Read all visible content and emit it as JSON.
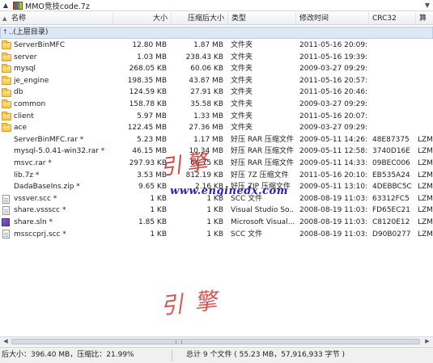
{
  "address_bar": {
    "path": "MMO竞技code.7z",
    "back_icon": "up-arrow-icon",
    "archive_icon": "archive-icon",
    "dropdown_icon": "chevron-down-icon"
  },
  "columns": {
    "name": "名称",
    "size": "大小",
    "packed": "压缩后大小",
    "type": "类型",
    "modified": "修改时间",
    "crc": "CRC32",
    "extra": "算"
  },
  "parent_row": {
    "label": "..(上层目录)"
  },
  "files": [
    {
      "icon": "folder",
      "name": "ServerBinMFC",
      "size": "12.80 MB",
      "packed": "1.87 MB",
      "type": "文件夹",
      "modified": "2011-05-16 20:09:...",
      "crc": "",
      "extra": ""
    },
    {
      "icon": "folder",
      "name": "server",
      "size": "1.03 MB",
      "packed": "238.43 KB",
      "type": "文件夹",
      "modified": "2011-05-16 19:39:...",
      "crc": "",
      "extra": ""
    },
    {
      "icon": "folder",
      "name": "mysql",
      "size": "268.05 KB",
      "packed": "60.06 KB",
      "type": "文件夹",
      "modified": "2009-03-27 09:29:...",
      "crc": "",
      "extra": ""
    },
    {
      "icon": "folder",
      "name": "je_engine",
      "size": "198.35 MB",
      "packed": "43.87 MB",
      "type": "文件夹",
      "modified": "2011-05-16 20:57:...",
      "crc": "",
      "extra": ""
    },
    {
      "icon": "folder",
      "name": "db",
      "size": "124.59 KB",
      "packed": "27.91 KB",
      "type": "文件夹",
      "modified": "2011-05-16 20:46:...",
      "crc": "",
      "extra": ""
    },
    {
      "icon": "folder",
      "name": "common",
      "size": "158.78 KB",
      "packed": "35.58 KB",
      "type": "文件夹",
      "modified": "2009-03-27 09:29:...",
      "crc": "",
      "extra": ""
    },
    {
      "icon": "folder",
      "name": "client",
      "size": "5.97 MB",
      "packed": "1.33 MB",
      "type": "文件夹",
      "modified": "2011-05-16 20:07:...",
      "crc": "",
      "extra": ""
    },
    {
      "icon": "folder",
      "name": "ace",
      "size": "122.45 MB",
      "packed": "27.36 MB",
      "type": "文件夹",
      "modified": "2009-03-27 09:29:...",
      "crc": "",
      "extra": ""
    },
    {
      "icon": "archive",
      "name": "ServerBinMFC.rar *",
      "size": "5.23 MB",
      "packed": "1.17 MB",
      "type": "好压 RAR 压缩文件",
      "modified": "2009-05-11 14:26:...",
      "crc": "48E87375",
      "extra": "LZM"
    },
    {
      "icon": "archive",
      "name": "mysql-5.0.41-win32.rar *",
      "size": "46.15 MB",
      "packed": "10.34 MB",
      "type": "好压 RAR 压缩文件",
      "modified": "2009-05-11 12:58:...",
      "crc": "3740D16E",
      "extra": "LZM"
    },
    {
      "icon": "archive",
      "name": "msvc.rar *",
      "size": "297.93 KB",
      "packed": "66.75 KB",
      "type": "好压 RAR 压缩文件",
      "modified": "2009-05-11 14:33:...",
      "crc": "09BEC006",
      "extra": "LZM"
    },
    {
      "icon": "archive",
      "name": "lib.7z *",
      "size": "3.53 MB",
      "packed": "812.19 KB",
      "type": "好压 7Z 压缩文件",
      "modified": "2011-05-16 20:10:...",
      "crc": "EB535A24",
      "extra": "LZM"
    },
    {
      "icon": "archive",
      "name": "DadaBaseIns.zip *",
      "size": "9.65 KB",
      "packed": "2.16 KB",
      "type": "好压 ZIP 压缩文件",
      "modified": "2009-05-11 13:10:...",
      "crc": "4DEBBC5C",
      "extra": "LZM"
    },
    {
      "icon": "doc",
      "name": "vssver.scc *",
      "size": "1 KB",
      "packed": "1 KB",
      "type": "SCC 文件",
      "modified": "2008-08-19 11:03:...",
      "crc": "63312FC5",
      "extra": "LZM"
    },
    {
      "icon": "doc",
      "name": "share.vssscc *",
      "size": "1 KB",
      "packed": "1 KB",
      "type": "Visual Studio So...",
      "modified": "2008-08-19 11:03:...",
      "crc": "FD65EC21",
      "extra": "LZM"
    },
    {
      "icon": "sln",
      "name": "share.sln *",
      "size": "1.85 KB",
      "packed": "1 KB",
      "type": "Microsoft Visual...",
      "modified": "2008-08-19 11:03:...",
      "crc": "C8120E12",
      "extra": "LZM"
    },
    {
      "icon": "doc",
      "name": "mssccprj.scc *",
      "size": "1 KB",
      "packed": "1 KB",
      "type": "SCC 文件",
      "modified": "2008-08-19 11:03:...",
      "crc": "D90B0277",
      "extra": "LZM"
    }
  ],
  "watermark": {
    "line1": "引擎",
    "url": "www.enginedx.com",
    "line3": "引擎"
  },
  "status_bar": {
    "left": "后大小：396.40 MB，压缩比：21.99%",
    "right": "总计 9 个文件 ( 55.23 MB，57,916,933 字节 )"
  },
  "colors": {
    "selection": "#dde8f7",
    "watermark_red": "#c8241e",
    "watermark_blue": "#2c1ec8"
  }
}
